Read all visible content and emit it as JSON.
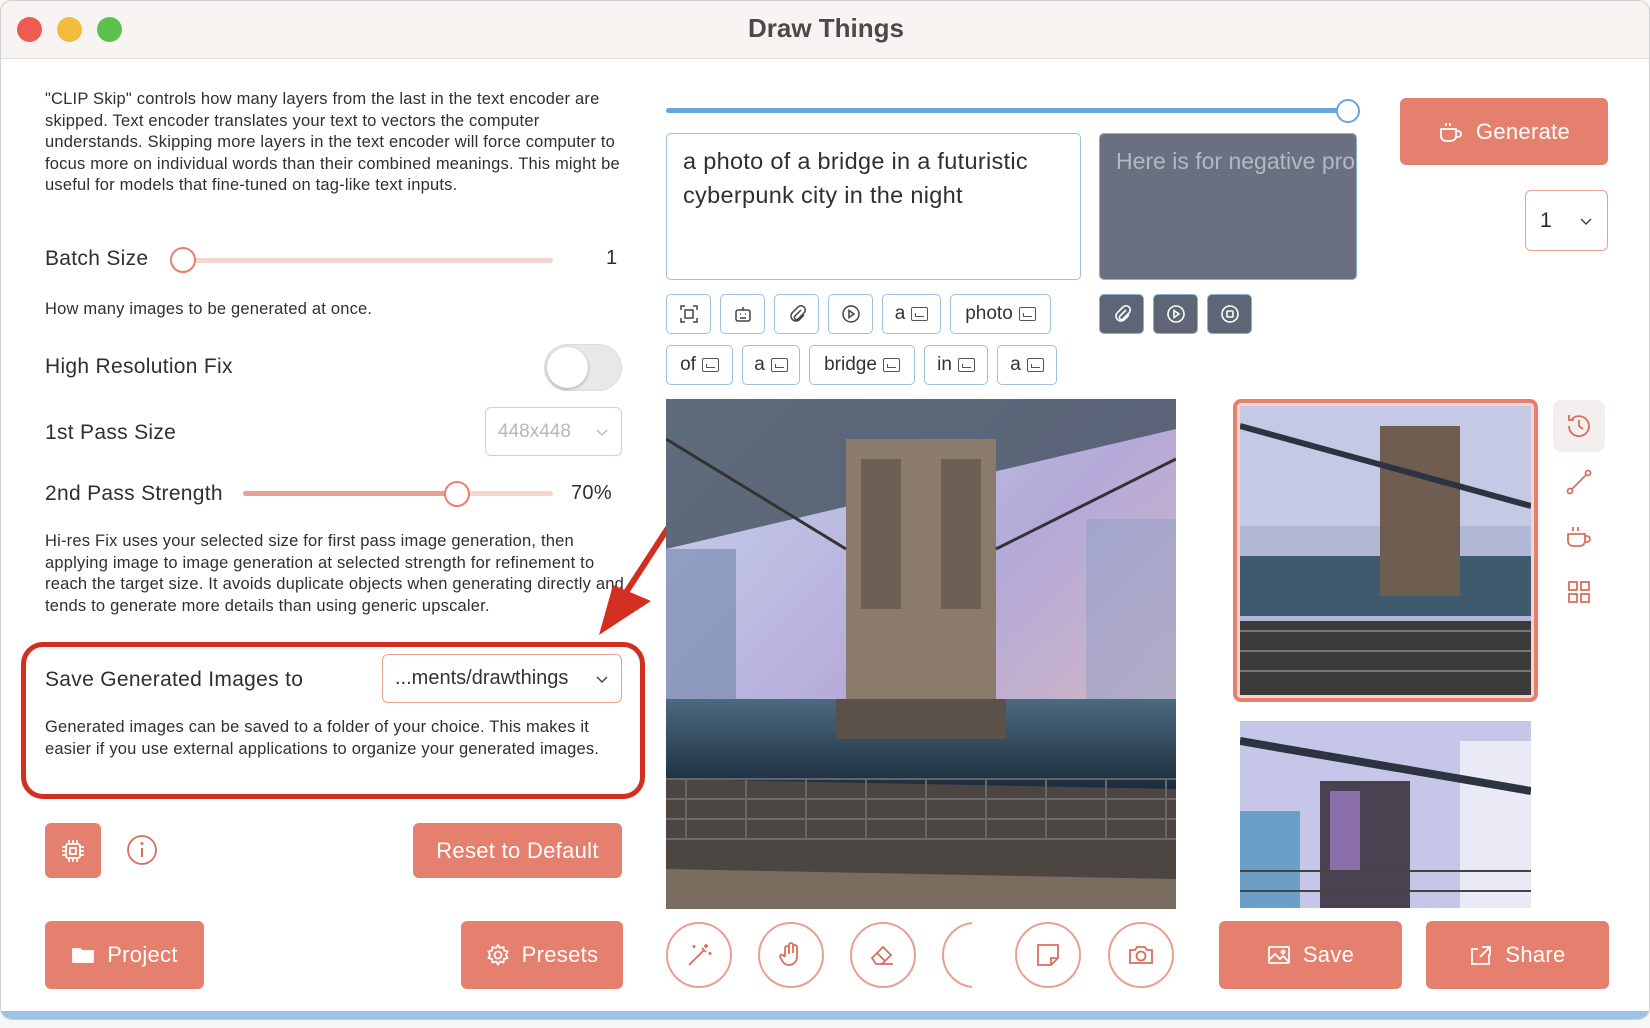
{
  "window": {
    "title": "Draw Things"
  },
  "clip_skip": {
    "description": "\"CLIP Skip\" controls how many layers from the last in the text encoder are skipped. Text encoder translates your text to vectors the computer understands. Skipping more layers in the text encoder will force computer to focus more on individual words than their combined meanings. This might be useful for models that fine-tuned on tag-like text inputs."
  },
  "batch_size": {
    "label": "Batch Size",
    "value": "1",
    "level": 0.0,
    "description": "How many images to be generated at once."
  },
  "high_res_fix": {
    "label": "High Resolution Fix",
    "enabled": false
  },
  "first_pass": {
    "label": "1st Pass Size",
    "value": "448x448"
  },
  "second_pass": {
    "label": "2nd Pass Strength",
    "value": "70%",
    "level": 0.7
  },
  "hires_description": "Hi-res Fix uses your selected size for first pass image generation, then applying image to image generation at selected strength for refinement to reach the target size. It avoids duplicate objects when generating directly and tends to generate more details than using generic upscaler.",
  "save_images": {
    "label": "Save Generated Images to",
    "value": "...ments/drawthings",
    "description": "Generated images can be saved to a folder of your choice. This makes it easier if you use external applications to organize your generated images."
  },
  "buttons": {
    "reset": "Reset to Default",
    "project": "Project",
    "presets": "Presets",
    "generate": "Generate",
    "save": "Save",
    "share": "Share"
  },
  "prompt": {
    "positive": "a photo of a bridge in a futuristic cyberpunk city in the night",
    "negative_placeholder": "Here is for negative prompt",
    "tokens": [
      "a",
      "photo",
      "of",
      "a",
      "bridge",
      "in",
      "a"
    ]
  },
  "image_count": "1",
  "icons": [
    "cpu-icon",
    "info-icon",
    "folder-icon",
    "gear-icon",
    "coffee-icon",
    "image-icon",
    "share-icon",
    "history-icon",
    "curve-icon",
    "grid-icon",
    "magic-wand-icon",
    "hand-icon",
    "eraser-icon",
    "note-icon",
    "camera-icon",
    "paperclip-icon",
    "play-icon",
    "stop-icon",
    "select-icon",
    "robot-icon"
  ],
  "colors": {
    "accent": "#e5806e",
    "annotation": "#d32f20",
    "slider": "#6aa6dc"
  }
}
